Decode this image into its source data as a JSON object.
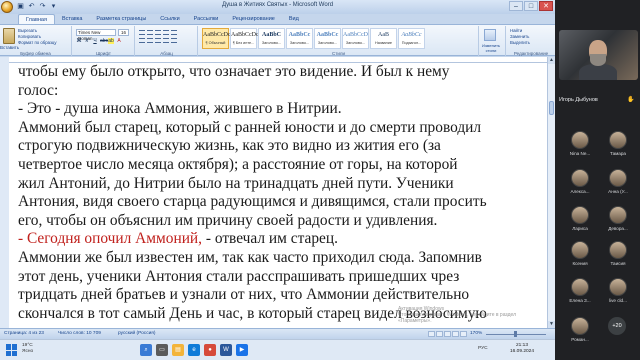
{
  "window": {
    "title": "Душа в Житиях Святых - Microsoft Word",
    "controls": [
      "–",
      "□",
      "✕"
    ]
  },
  "ribbon_tabs": [
    "Главная",
    "Вставка",
    "Разметка страницы",
    "Ссылки",
    "Рассылки",
    "Рецензирование",
    "Вид"
  ],
  "ribbon": {
    "clipboard": {
      "paste": "Вставить",
      "cut": "Вырезать",
      "copy": "Копировать",
      "format_painter": "Формат по образцу",
      "label": "Буфер обмена"
    },
    "font": {
      "name": "Times New Roman",
      "size": "16",
      "label": "Шрифт"
    },
    "paragraph": {
      "label": "Абзац"
    },
    "styles": {
      "items": [
        {
          "sample": "AaBbCcDc",
          "name": "¶ Обычный"
        },
        {
          "sample": "AaBbCcDc",
          "name": "¶ Без инте..."
        },
        {
          "sample": "AaBbC",
          "name": "Заголово..."
        },
        {
          "sample": "AaBbCc",
          "name": "Заголово..."
        },
        {
          "sample": "AaBbCc",
          "name": "Заголово..."
        },
        {
          "sample": "AaBbCcD",
          "name": "Заголово..."
        },
        {
          "sample": "AaB",
          "name": "Название"
        },
        {
          "sample": "AaBbCc",
          "name": "Подзагол..."
        }
      ],
      "change_styles": "Изменить стили",
      "label": "Стили"
    },
    "editing": {
      "find": "Найти",
      "replace": "Заменить",
      "select": "Выделить",
      "label": "Редактирование"
    }
  },
  "document": {
    "lines": [
      {
        "text": "чтобы ему было открыто, что означает это видение. И был к нему",
        "red": false
      },
      {
        "text": "голос:",
        "red": false
      },
      {
        "text": "- Это - душа инока Аммония, жившего в Нитрии.",
        "red": true
      },
      {
        "text": "Аммоний был старец, который с ранней юности и до смерти проводил",
        "red": false
      },
      {
        "text": "строгую подвижническую жизнь, как это видно из жития его (за",
        "red": false
      },
      {
        "text": "четвертое число месяца октября); а расстояние от горы, на которой",
        "red": false
      },
      {
        "text": "жил Антоний, до Нитрии было на тринадцать дней пути. Ученики",
        "red": false
      },
      {
        "text": "Антония, видя своего старца радующимся и дивящимся, стали просить",
        "red": false
      },
      {
        "text": "его, чтобы он объяснил им причину своей радости и удивления.",
        "red": false
      },
      {
        "red_part": "- Сегодня опочил Аммоний,",
        "rest": " - отвечал им старец."
      },
      {
        "text": "Аммонии же был известен им, так как часто приходил сюда. Запомнив",
        "red": false
      },
      {
        "text": "этот день, ученики Антония стали расспрашивать пришедших чрез",
        "red": false
      },
      {
        "text": "тридцать дней братьев и узнали от них, что Аммонии действительно",
        "red": false
      },
      {
        "text": "скончался в тот самый День и час, в который старец видел возносимую",
        "red": false
      }
    ]
  },
  "statusbar": {
    "page": "Страница: 4 из 23",
    "words": "Число слов: 10 709",
    "language": "русский (Россия)",
    "zoom": "170%"
  },
  "watermark": {
    "line1": "Активация Windows",
    "line2": "Чтобы активировать Windows, перейдите в раздел «Параметры»."
  },
  "taskbar": {
    "weather_temp": "19°C",
    "weather_desc": "Ясно",
    "tray_lang": "РУС",
    "time": "21:13",
    "date": "16.09.2024"
  },
  "meeting": {
    "host_name": "Игорь Дыбунов",
    "participants": [
      {
        "name": "Nina Ne..."
      },
      {
        "name": "Тамара"
      },
      {
        "name": "Алекса..."
      },
      {
        "name": "Анна (У..."
      },
      {
        "name": "Лариса"
      },
      {
        "name": "Девора..."
      },
      {
        "name": "Ксения"
      },
      {
        "name": "Таисия"
      },
      {
        "name": "Елена З..."
      },
      {
        "name": "live cld..."
      },
      {
        "name": "Роман..."
      }
    ],
    "more_count": "+20"
  },
  "colors": {
    "ribbon_blue": "#c5d6ec",
    "accent_red": "#c0201c",
    "meeting_bg": "#202124"
  }
}
